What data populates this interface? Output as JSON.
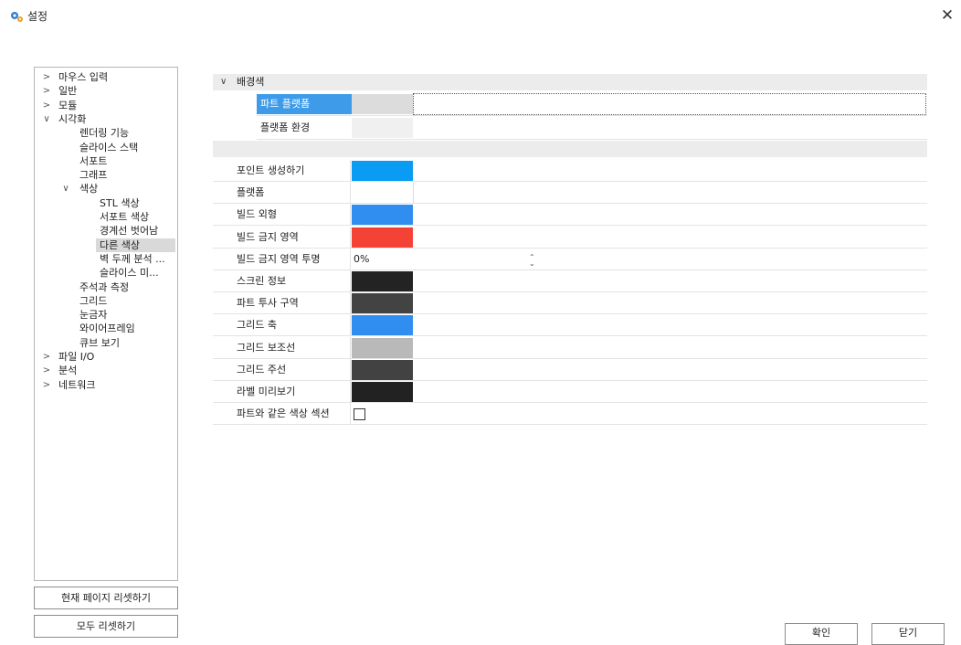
{
  "window": {
    "title": "설정",
    "icon": "gears-icon",
    "close_glyph": "✕"
  },
  "tree": {
    "items": [
      {
        "label": "마우스 입력",
        "chevron": ">"
      },
      {
        "label": "일반",
        "chevron": ">"
      },
      {
        "label": "모듈",
        "chevron": ">"
      },
      {
        "label": "시각화",
        "chevron": "∨"
      },
      {
        "label": "렌더링 기능",
        "chevron": ""
      },
      {
        "label": "슬라이스 스택",
        "chevron": ""
      },
      {
        "label": "서포트",
        "chevron": ""
      },
      {
        "label": "그래프",
        "chevron": ""
      },
      {
        "label": "색상",
        "chevron": "∨"
      },
      {
        "label": "STL 색상",
        "chevron": ""
      },
      {
        "label": "서포트 색상",
        "chevron": ""
      },
      {
        "label": "경계선 벗어남",
        "chevron": ""
      },
      {
        "label": "다른 색상",
        "chevron": "",
        "selected": true
      },
      {
        "label": "벽 두께 분석 ...",
        "chevron": ""
      },
      {
        "label": "슬라이스 미...",
        "chevron": ""
      },
      {
        "label": "주석과 측정",
        "chevron": ""
      },
      {
        "label": "그리드",
        "chevron": ""
      },
      {
        "label": "눈금자",
        "chevron": ""
      },
      {
        "label": "와이어프레임",
        "chevron": ""
      },
      {
        "label": "큐브 보기",
        "chevron": ""
      },
      {
        "label": "파일 I/O",
        "chevron": ">"
      },
      {
        "label": "분석",
        "chevron": ">"
      },
      {
        "label": "네트워크",
        "chevron": ">"
      }
    ]
  },
  "buttons": {
    "reset_page": "현재 페이지 리셋하기",
    "reset_all": "모두 리셋하기",
    "ok": "확인",
    "close": "닫기"
  },
  "properties": {
    "category": {
      "label": "배경색",
      "chevron": "∨"
    },
    "background": [
      {
        "label": "파트 플랫폼",
        "color": "#dcdcdc",
        "selected": true
      },
      {
        "label": "플랫폼 환경",
        "color": "#f0f0f0"
      }
    ],
    "rows": [
      {
        "label": "포인트 생성하기",
        "color": "#0a9cf2"
      },
      {
        "label": "플랫폼",
        "color": "#ffffff"
      },
      {
        "label": "빌드 외형",
        "color": "#2f8ef0"
      },
      {
        "label": "빌드 금지 영역",
        "color": "#f44336"
      },
      {
        "label": "빌드 금지 영역 투명",
        "value": "0%",
        "spin": "⌃⌄"
      },
      {
        "label": "스크린 정보",
        "color": "#232323"
      },
      {
        "label": "파트 투사 구역",
        "color": "#434343"
      },
      {
        "label": "그리드 축",
        "color": "#2f8ef0"
      },
      {
        "label": "그리드 보조선",
        "color": "#b9b9b9"
      },
      {
        "label": "그리드 주선",
        "color": "#424242"
      },
      {
        "label": "라벨 미리보기",
        "color": "#222222"
      },
      {
        "label": "파트와 같은 색상 섹션",
        "checkbox": false
      }
    ]
  }
}
